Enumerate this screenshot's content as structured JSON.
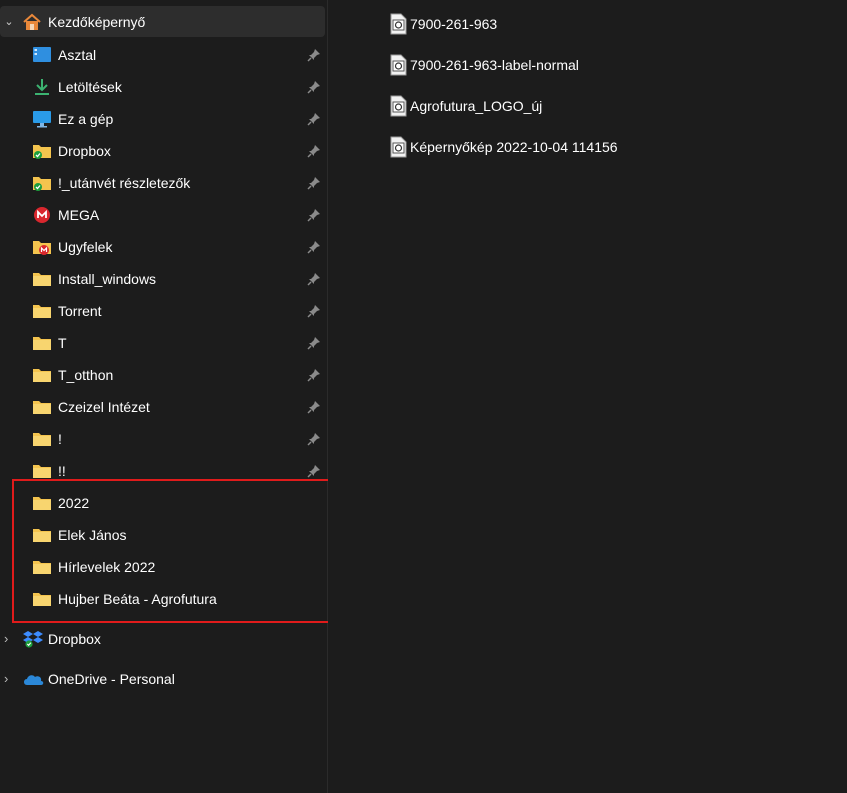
{
  "nav": {
    "home": {
      "label": "Kezdőképernyő",
      "icon": "home-icon"
    },
    "items": [
      {
        "label": "Asztal",
        "icon": "desktop-icon",
        "pinned": true
      },
      {
        "label": "Letöltések",
        "icon": "download-icon",
        "pinned": true
      },
      {
        "label": "Ez a gép",
        "icon": "computer-icon",
        "pinned": true
      },
      {
        "label": "Dropbox",
        "icon": "folder-synced-icon",
        "pinned": true
      },
      {
        "label": "!_utánvét részletezők",
        "icon": "folder-synced-icon",
        "pinned": true
      },
      {
        "label": "MEGA",
        "icon": "mega-icon",
        "pinned": true
      },
      {
        "label": "Ugyfelek",
        "icon": "folder-mega-icon",
        "pinned": true
      },
      {
        "label": "Install_windows",
        "icon": "folder-icon",
        "pinned": true
      },
      {
        "label": "Torrent",
        "icon": "folder-icon",
        "pinned": true
      },
      {
        "label": "T",
        "icon": "folder-icon",
        "pinned": true
      },
      {
        "label": "T_otthon",
        "icon": "folder-icon",
        "pinned": true
      },
      {
        "label": "Czeizel Intézet",
        "icon": "folder-icon",
        "pinned": true
      },
      {
        "label": "!",
        "icon": "folder-icon",
        "pinned": true
      },
      {
        "label": "!!",
        "icon": "folder-icon",
        "pinned": true
      },
      {
        "label": "2022",
        "icon": "folder-icon",
        "pinned": false
      },
      {
        "label": "Elek János",
        "icon": "folder-icon",
        "pinned": false
      },
      {
        "label": "Hírlevelek 2022",
        "icon": "folder-icon",
        "pinned": false
      },
      {
        "label": "Hujber Beáta - Agrofutura",
        "icon": "folder-icon",
        "pinned": false
      }
    ],
    "roots": [
      {
        "label": "Dropbox",
        "icon": "dropbox-icon"
      },
      {
        "label": "OneDrive - Personal",
        "icon": "onedrive-icon"
      }
    ]
  },
  "files": [
    {
      "name": "7900-261-963",
      "icon": "image-file-icon"
    },
    {
      "name": "7900-261-963-label-normal",
      "icon": "image-file-icon"
    },
    {
      "name": "Agrofutura_LOGO_új",
      "icon": "image-file-icon"
    },
    {
      "name": "Képernyőkép 2022-10-04 114156",
      "icon": "image-file-icon"
    }
  ],
  "colors": {
    "background": "#1c1c1c",
    "selected_row": "#2d2d2d",
    "folder": "#f4c44e",
    "highlight_box": "#e01b1b",
    "sync_green": "#1e9e3e",
    "mega_red": "#d9272e",
    "dropbox_blue": "#0061fe",
    "onedrive_blue": "#2b88d8"
  }
}
